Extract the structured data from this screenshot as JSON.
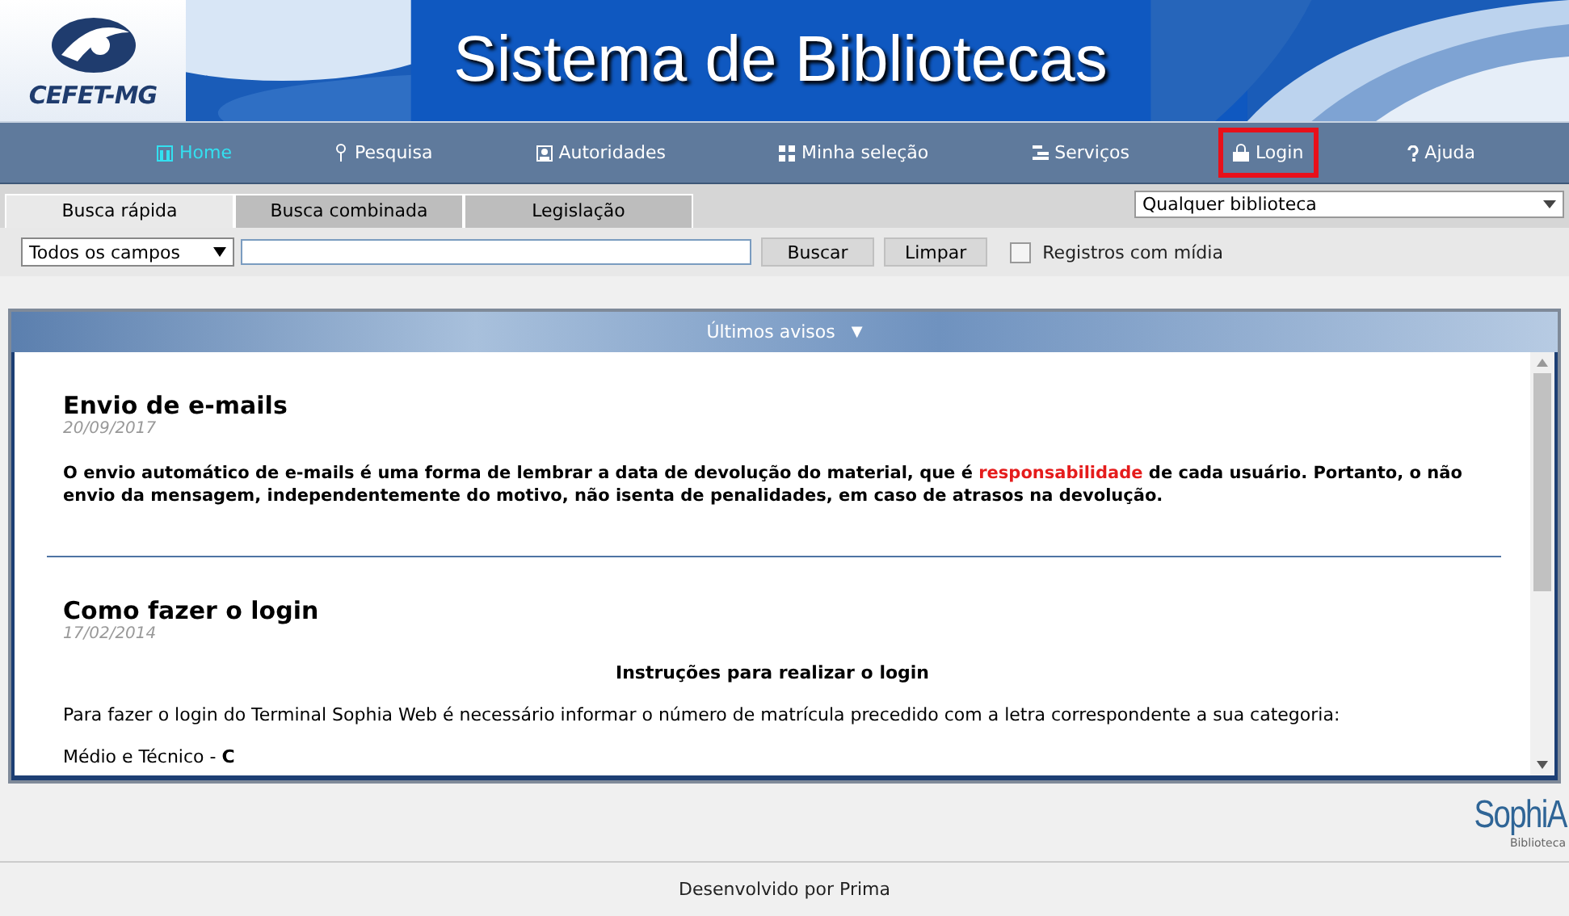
{
  "header": {
    "logo": "CEFET-MG",
    "title": "Sistema de Bibliotecas"
  },
  "nav": [
    {
      "label": "Home",
      "kind": "home",
      "selected": true,
      "highlighted": false
    },
    {
      "label": "Pesquisa",
      "kind": "pin",
      "selected": false,
      "highlighted": false
    },
    {
      "label": "Autoridades",
      "kind": "person",
      "selected": false,
      "highlighted": false
    },
    {
      "label": "Minha seleção",
      "kind": "grid",
      "selected": false,
      "highlighted": false
    },
    {
      "label": "Serviços",
      "kind": "list",
      "selected": false,
      "highlighted": false
    },
    {
      "label": "Login",
      "kind": "lock",
      "selected": false,
      "highlighted": true
    },
    {
      "label": "Ajuda",
      "kind": "help",
      "selected": false,
      "highlighted": false
    }
  ],
  "tabs": [
    {
      "label": "Busca rápida",
      "selected": true
    },
    {
      "label": "Busca combinada",
      "selected": false
    },
    {
      "label": "Legislação",
      "selected": false
    }
  ],
  "library_select": {
    "value": "Qualquer biblioteca"
  },
  "search": {
    "field_select": "Todos os campos",
    "buttons": [
      "Buscar",
      "Limpar"
    ],
    "media_checkbox": {
      "label": "Registros com mídia",
      "checked": false
    }
  },
  "notices": {
    "title": "Últimos avisos",
    "toggle": "▼",
    "items": [
      {
        "title": "Envio de e-mails",
        "date": "20/09/2017",
        "blocks": [
          {
            "kind": "bold",
            "parts": [
              {
                "text": "O envio automático de e-mails é uma forma de lembrar a data de devolução do material, que é ",
                "emphasis": false
              },
              {
                "text": "responsabilidade",
                "emphasis": true
              },
              {
                "text": " de cada usuário. Portanto, o não envio da mensagem, independentemente do motivo, não isenta de penalidades, em caso de atrasos na devolução.",
                "emphasis": false
              }
            ]
          }
        ]
      },
      {
        "title": "Como fazer o login",
        "date": "17/02/2014",
        "blocks": [
          {
            "kind": "heading",
            "parts": [
              {
                "text": "Instruções para realizar o login",
                "emphasis": false
              }
            ]
          },
          {
            "kind": "plain",
            "parts": [
              {
                "text": "Para fazer o login do Terminal Sophia Web é necessário informar o número de matrícula precedido com a letra correspondente a sua categoria:",
                "emphasis": false
              }
            ]
          },
          {
            "kind": "rich",
            "parts": [
              {
                "text": "Médio e Técnico - **C**",
                "emphasis": false
              }
            ]
          }
        ]
      }
    ]
  },
  "brand": {
    "name": "SophiA",
    "sub": "Biblioteca"
  },
  "footer": "Desenvolvido por Prima"
}
